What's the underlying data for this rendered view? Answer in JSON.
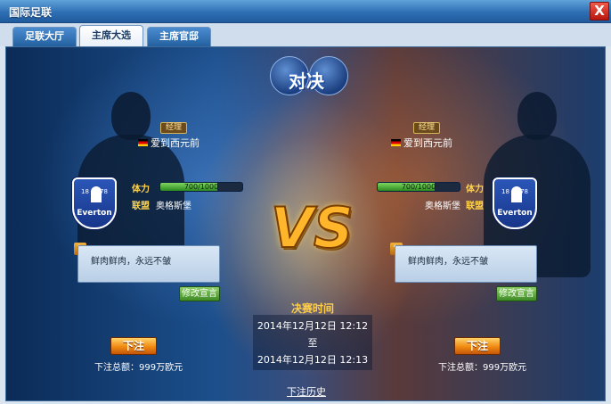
{
  "window": {
    "title": "国际足联",
    "close_glyph": "X"
  },
  "tabs": [
    {
      "label": "足联大厅",
      "active": false
    },
    {
      "label": "主席大选",
      "active": true
    },
    {
      "label": "主席官邸",
      "active": false
    }
  ],
  "duel": {
    "title": "对决",
    "vs": "VS"
  },
  "left": {
    "badge": "经理",
    "manager": "爱到西元前",
    "stamina_label": "体力",
    "stamina_text": "700/1000",
    "stamina_fraction": 0.7,
    "league_label": "联盟",
    "league_name": "奥格斯堡",
    "crest": {
      "year_left": "18",
      "year_right": "78",
      "name": "Everton"
    },
    "quote": "鲜肉鲜肉，永远不皱",
    "edit_label": "修改宣言",
    "bet_label": "下注",
    "bet_total": "下注总额：999万欧元"
  },
  "right": {
    "badge": "经理",
    "manager": "爱到西元前",
    "stamina_label": "体力",
    "stamina_text": "700/1000",
    "stamina_fraction": 0.7,
    "league_label": "联盟",
    "league_name": "奥格斯堡",
    "crest": {
      "year_left": "18",
      "year_right": "78",
      "name": "Everton"
    },
    "quote": "鲜肉鲜肉，永远不皱",
    "edit_label": "修改宣言",
    "bet_label": "下注",
    "bet_total": "下注总额：999万欧元"
  },
  "final": {
    "label": "决赛时间",
    "start": "2014年12月12日  12:12",
    "to": "至",
    "end": "2014年12月12日  12:13"
  },
  "history_link": "下注历史",
  "icons": {
    "quote": "quote-icon",
    "flag": "flag-icon",
    "crest": "crest-icon",
    "football": "football-icon"
  }
}
